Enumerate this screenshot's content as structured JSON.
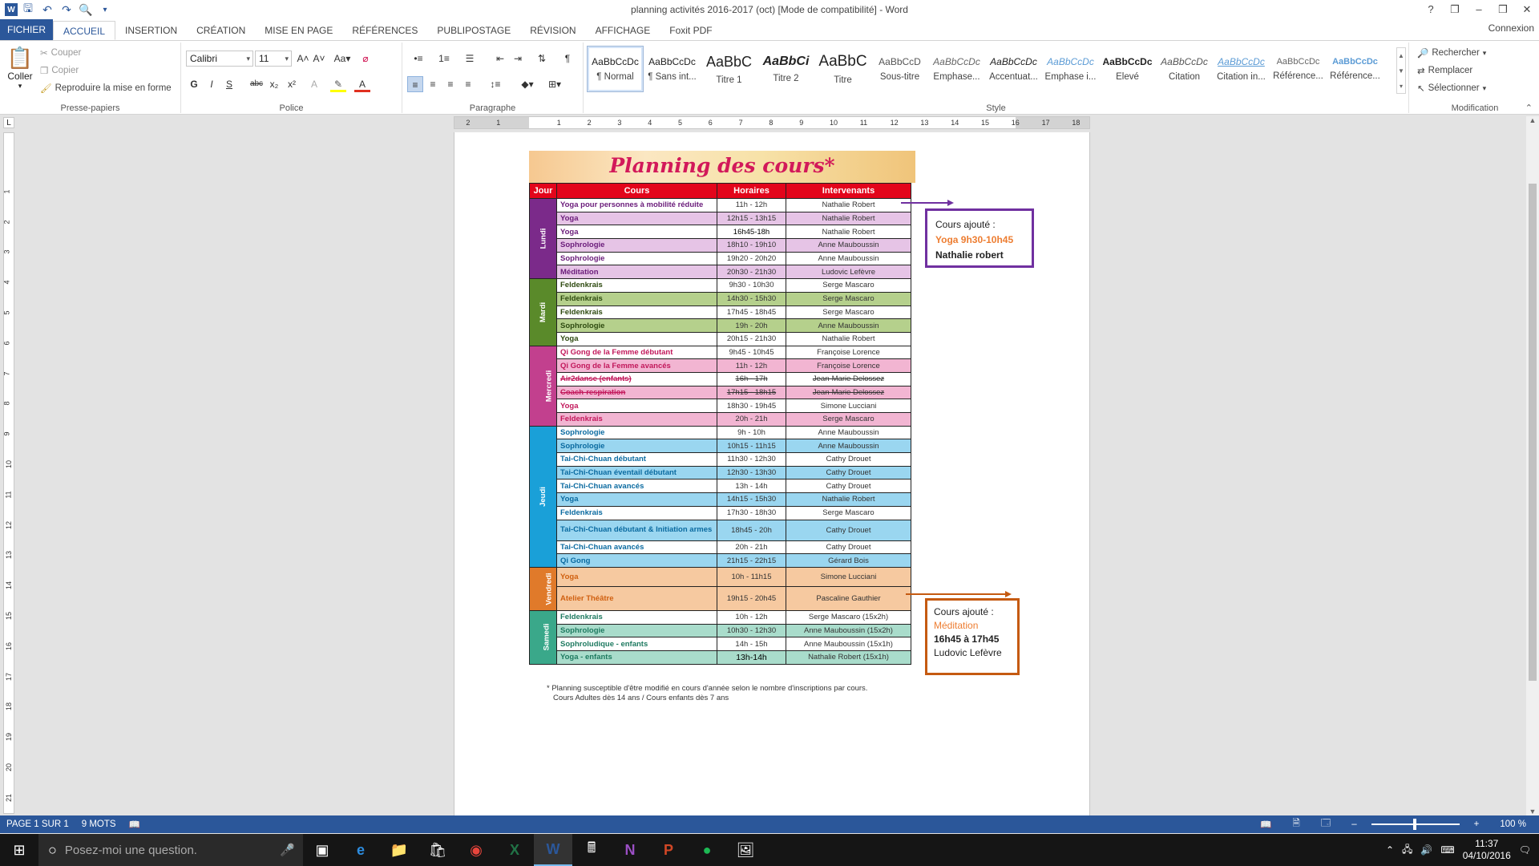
{
  "window": {
    "title": "planning activités 2016-2017 (oct) [Mode de compatibilité] - Word",
    "connexion": "Connexion"
  },
  "tabs": [
    "FICHIER",
    "ACCUEIL",
    "INSERTION",
    "CRÉATION",
    "MISE EN PAGE",
    "RÉFÉRENCES",
    "PUBLIPOSTAGE",
    "RÉVISION",
    "AFFICHAGE",
    "Foxit PDF"
  ],
  "clipboard": {
    "coller": "Coller",
    "couper": "Couper",
    "copier": "Copier",
    "reproduire": "Reproduire la mise en forme",
    "label": "Presse-papiers"
  },
  "font": {
    "name": "Calibri",
    "size": "11",
    "label": "Police"
  },
  "paragraph": {
    "label": "Paragraphe"
  },
  "styles": {
    "label": "Style",
    "items": [
      {
        "preview": "AaBbCcDc",
        "name": "¶ Normal"
      },
      {
        "preview": "AaBbCcDc",
        "name": "¶ Sans int..."
      },
      {
        "preview": "AaBbC",
        "name": "Titre 1"
      },
      {
        "preview": "AaBbCi",
        "name": "Titre 2"
      },
      {
        "preview": "AaBbC",
        "name": "Titre"
      },
      {
        "preview": "AaBbCcD",
        "name": "Sous-titre"
      },
      {
        "preview": "AaBbCcDc",
        "name": "Emphase..."
      },
      {
        "preview": "AaBbCcDc",
        "name": "Accentuat..."
      },
      {
        "preview": "AaBbCcDc",
        "name": "Emphase i..."
      },
      {
        "preview": "AaBbCcDc",
        "name": "Élevé"
      },
      {
        "preview": "AaBbCcDc",
        "name": "Citation"
      },
      {
        "preview": "AaBbCcDc",
        "name": "Citation in..."
      },
      {
        "preview": "AaBbCcDc",
        "name": "Référence..."
      },
      {
        "preview": "AaBbCcDc",
        "name": "Référence..."
      }
    ]
  },
  "editing": {
    "rechercher": "Rechercher",
    "remplacer": "Remplacer",
    "selectionner": "Sélectionner",
    "label": "Modification"
  },
  "planning": {
    "title": "Planning des cours*",
    "headers": {
      "jour": "Jour",
      "cours": "Cours",
      "horaires": "Horaires",
      "intervenants": "Intervenants"
    },
    "days": [
      "Lundi",
      "Mardi",
      "Mercredi",
      "Jeudi",
      "Vendredi",
      "Samedi"
    ],
    "rows": [
      [
        "Yoga pour personnes à mobilité réduite",
        "11h - 12h",
        "Nathalie Robert"
      ],
      [
        "Yoga",
        "12h15 - 13h15",
        "Nathalie Robert"
      ],
      [
        "Yoga",
        "16h45-18h",
        "Nathalie Robert"
      ],
      [
        "Sophrologie",
        "18h10 - 19h10",
        "Anne Mauboussin"
      ],
      [
        "Sophrologie",
        "19h20 - 20h20",
        "Anne Mauboussin"
      ],
      [
        "Méditation",
        "20h30 - 21h30",
        "Ludovic Lefèvre"
      ],
      [
        "Feldenkrais",
        "9h30 - 10h30",
        "Serge Mascaro"
      ],
      [
        "Feldenkrais",
        "14h30 - 15h30",
        "Serge Mascaro"
      ],
      [
        "Feldenkrais",
        "17h45 - 18h45",
        "Serge Mascaro"
      ],
      [
        "Sophrologie",
        "19h - 20h",
        "Anne Mauboussin"
      ],
      [
        "Yoga",
        "20h15 - 21h30",
        "Nathalie Robert"
      ],
      [
        "Qi Gong de la Femme débutant",
        "9h45 - 10h45",
        "Françoise Lorence"
      ],
      [
        "Qi Gong de la Femme avancés",
        "11h - 12h",
        "Françoise Lorence"
      ],
      [
        "Air2danse (enfants)",
        "16h - 17h",
        "Jean-Marie Delossez"
      ],
      [
        "Coach-respiration",
        "17h15 - 18h15",
        "Jean-Marie Delossez"
      ],
      [
        "Yoga",
        "18h30 - 19h45",
        "Simone Lucciani"
      ],
      [
        "Feldenkrais",
        "20h - 21h",
        "Serge Mascaro"
      ],
      [
        "Sophrologie",
        "9h - 10h",
        "Anne Mauboussin"
      ],
      [
        "Sophrologie",
        "10h15 - 11h15",
        "Anne Mauboussin"
      ],
      [
        "Tai-Chi-Chuan débutant",
        "11h30 - 12h30",
        "Cathy Drouet"
      ],
      [
        "Tai-Chi-Chuan éventail débutant",
        "12h30 - 13h30",
        "Cathy Drouet"
      ],
      [
        "Tai-Chi-Chuan avancés",
        "13h - 14h",
        "Cathy Drouet"
      ],
      [
        "Yoga",
        "14h15 - 15h30",
        "Nathalie Robert"
      ],
      [
        "Feldenkrais",
        "17h30 - 18h30",
        "Serge Mascaro"
      ],
      [
        "Tai-Chi-Chuan débutant & Initiation armes",
        "18h45 - 20h",
        "Cathy Drouet"
      ],
      [
        "Tai-Chi-Chuan avancés",
        "20h - 21h",
        "Cathy Drouet"
      ],
      [
        "Qi Gong",
        "21h15 - 22h15",
        "Gérard Bois"
      ],
      [
        "Yoga",
        "10h - 11h15",
        "Simone Lucciani"
      ],
      [
        "Atelier Théâtre",
        "19h15 - 20h45",
        "Pascaline Gauthier"
      ],
      [
        "Feldenkrais",
        "10h - 12h",
        "Serge Mascaro (15x2h)"
      ],
      [
        "Sophrologie",
        "10h30 - 12h30",
        "Anne Mauboussin (15x2h)"
      ],
      [
        "Sophroludique - enfants",
        "14h - 15h",
        "Anne Mauboussin (15x1h)"
      ],
      [
        "Yoga - enfants",
        "13h-14h",
        "Nathalie Robert (15x1h)"
      ]
    ],
    "footnote1": "* Planning susceptible d'être modifié en cours d'année selon le nombre d'inscriptions par cours.",
    "footnote2": "Cours Adultes dès 14 ans / Cours enfants dès 7 ans"
  },
  "callout1": {
    "title": "Cours ajouté :",
    "course": "Yoga 9h30-10h45",
    "teacher": "Nathalie robert"
  },
  "callout2": {
    "title": "Cours ajouté :",
    "course": "Méditation",
    "time": "16h45 à 17h45",
    "teacher": "Ludovic Lefèvre"
  },
  "status": {
    "page": "PAGE 1 SUR 1",
    "words": "9 MOTS",
    "zoom": "100 %"
  },
  "taskbar": {
    "search": "Posez-moi une question.",
    "time": "11:37",
    "date": "04/10/2016"
  },
  "colors": {
    "word_blue": "#2b579a",
    "lundi": "#7b2a8a",
    "mardi": "#5a8a2a",
    "mercredi": "#c2408e",
    "jeudi": "#1aa0d8",
    "vendredi": "#e07a2a",
    "samedi": "#3aa88a"
  }
}
